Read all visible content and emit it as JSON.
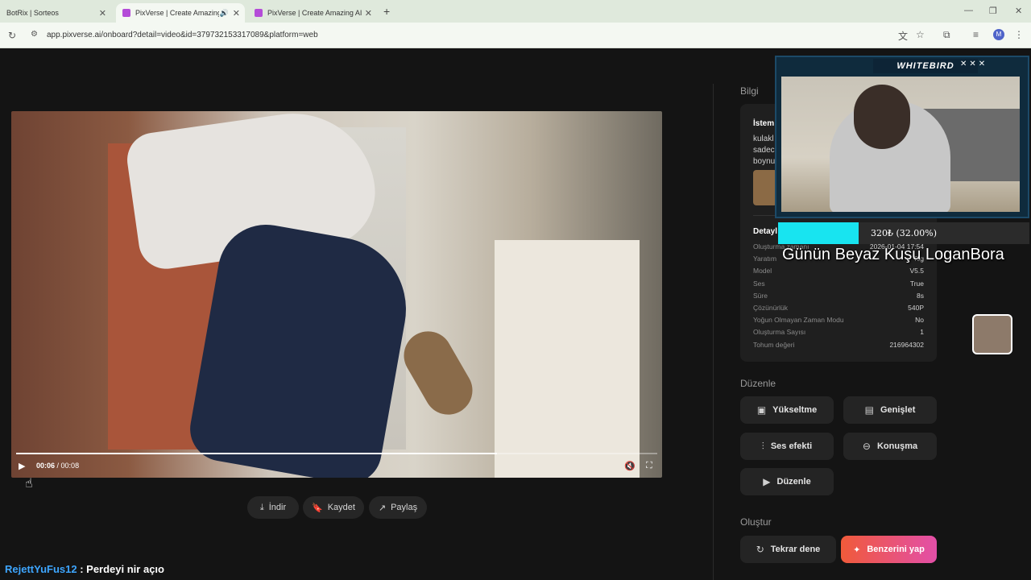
{
  "browser": {
    "tabs": [
      {
        "title": "BotRix | Sorteos"
      },
      {
        "title": "PixVerse | Create Amazing AI"
      },
      {
        "title": "PixVerse | Create Amazing AI V"
      }
    ],
    "url": "app.pixverse.ai/onboard?detail=video&id=379732153317089&platform=web",
    "profile_initial": "M"
  },
  "player": {
    "current_time": "00:06",
    "duration": "00:08",
    "progress_fraction": 0.75
  },
  "actions": {
    "download": "İndir",
    "save": "Kaydet",
    "share": "Paylaş"
  },
  "panel": {
    "info_title": "Bilgi",
    "prompt_heading": "İstem",
    "prompt_lines": [
      "kulakl",
      "sadec",
      "boynu"
    ],
    "details_heading": "Detayl",
    "details": [
      {
        "key": "Oluşturma zamanı",
        "value": "2026-01-04 17:54"
      },
      {
        "key": "Yaratım",
        "value": "Tcg"
      },
      {
        "key": "Model",
        "value": "V5.5"
      },
      {
        "key": "Ses",
        "value": "True"
      },
      {
        "key": "Süre",
        "value": "8s"
      },
      {
        "key": "Çözünürlük",
        "value": "540P"
      },
      {
        "key": "Yoğun Olmayan Zaman Modu",
        "value": "No"
      },
      {
        "key": "Oluşturma Sayısı",
        "value": "1"
      },
      {
        "key": "Tohum değeri",
        "value": "216964302"
      }
    ],
    "edit_title": "Düzenle",
    "edit_buttons": {
      "upscale": "Yükseltme",
      "extend": "Genişlet",
      "sound_effect": "Ses efekti",
      "speech": "Konuşma",
      "edit": "Düzenle"
    },
    "create_title": "Oluştur",
    "retry": "Tekrar dene",
    "make_similar": "Benzerini yap"
  },
  "stream_overlay": {
    "brand": "WHITEBIRD",
    "goal_text": "320₺ (32.00%)",
    "goal_fraction": 0.32,
    "goal_title": "Günün Beyaz Kuşu LoganBora",
    "goal_color": "#18e4f0"
  },
  "chat": {
    "user": "RejettYuFus12",
    "message": ": Perdeyi nir açıo"
  }
}
